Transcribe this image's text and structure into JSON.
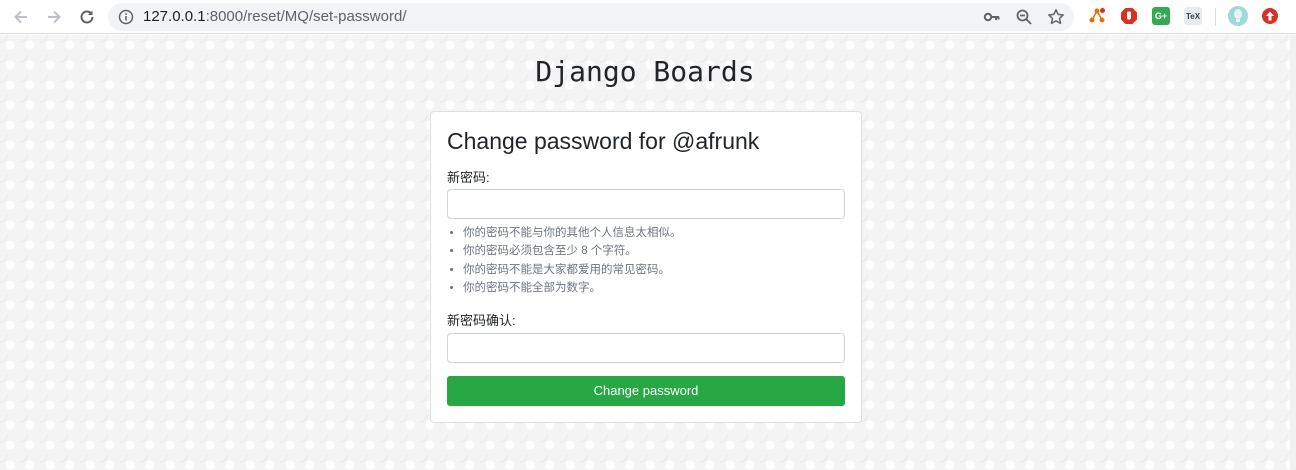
{
  "browser": {
    "url_host": "127.0.0.1",
    "url_rest": ":8000/reset/MQ/set-password/",
    "icons": [
      "back-icon",
      "forward-icon",
      "reload-icon",
      "info-icon",
      "key-icon",
      "zoom-icon",
      "star-icon"
    ],
    "extensions": [
      {
        "name": "network-extension-icon",
        "color": "#e8710a"
      },
      {
        "name": "adblock-extension-icon",
        "color": "#d93025"
      },
      {
        "name": "gplus-extension-icon",
        "color": "#34a853",
        "text": "G+"
      },
      {
        "name": "tex-extension-icon",
        "color": "#5f6368",
        "text": "TeX"
      },
      {
        "name": "profile-avatar-icon",
        "color": "#9fd8d8"
      },
      {
        "name": "update-extension-icon",
        "color": "#d93025"
      }
    ]
  },
  "page": {
    "brand": "Django Boards",
    "card": {
      "title": "Change password for @afrunk",
      "new_password_label": "新密码:",
      "help": [
        "你的密码不能与你的其他个人信息太相似。",
        "你的密码必须包含至少 8 个字符。",
        "你的密码不能是大家都爱用的常见密码。",
        "你的密码不能全部为数字。"
      ],
      "confirm_label": "新密码确认:",
      "submit_label": "Change password"
    }
  },
  "colors": {
    "accent": "#28a745",
    "text": "#212529",
    "muted": "#6c757d"
  }
}
